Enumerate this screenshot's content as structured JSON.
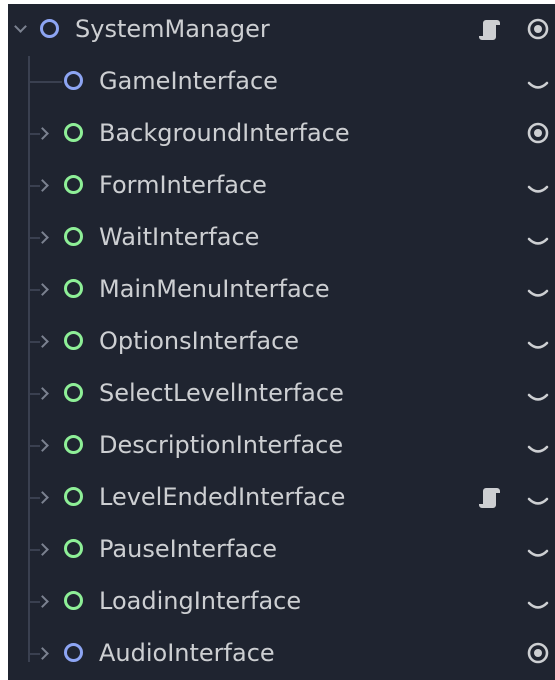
{
  "tree": {
    "root": {
      "label": "SystemManager",
      "icon": "node-icon-blue",
      "expanded": true,
      "has_script": true,
      "visible": true
    },
    "children": [
      {
        "label": "GameInterface",
        "icon": "node-icon-blue",
        "has_arrow": false,
        "has_script": false,
        "visible": false
      },
      {
        "label": "BackgroundInterface",
        "icon": "control-icon-green",
        "has_arrow": true,
        "has_script": false,
        "visible": true
      },
      {
        "label": "FormInterface",
        "icon": "control-icon-green",
        "has_arrow": true,
        "has_script": false,
        "visible": false
      },
      {
        "label": "WaitInterface",
        "icon": "control-icon-green",
        "has_arrow": true,
        "has_script": false,
        "visible": false
      },
      {
        "label": "MainMenuInterface",
        "icon": "control-icon-green",
        "has_arrow": true,
        "has_script": false,
        "visible": false
      },
      {
        "label": "OptionsInterface",
        "icon": "control-icon-green",
        "has_arrow": true,
        "has_script": false,
        "visible": false
      },
      {
        "label": "SelectLevelInterface",
        "icon": "control-icon-green",
        "has_arrow": true,
        "has_script": false,
        "visible": false
      },
      {
        "label": "DescriptionInterface",
        "icon": "control-icon-green",
        "has_arrow": true,
        "has_script": false,
        "visible": false
      },
      {
        "label": "LevelEndedInterface",
        "icon": "control-icon-green",
        "has_arrow": true,
        "has_script": true,
        "visible": false
      },
      {
        "label": "PauseInterface",
        "icon": "control-icon-green",
        "has_arrow": true,
        "has_script": false,
        "visible": false
      },
      {
        "label": "LoadingInterface",
        "icon": "control-icon-green",
        "has_arrow": true,
        "has_script": false,
        "visible": false
      },
      {
        "label": "AudioInterface",
        "icon": "node-icon-blue",
        "has_arrow": true,
        "has_script": false,
        "visible": true
      }
    ]
  },
  "colors": {
    "background": "#1f2430",
    "text": "#cdcfd2",
    "node_blue": "#8da5f3",
    "control_green": "#8eef97",
    "tree_line": "#3a4050",
    "icon_grey": "#cdcfd2"
  }
}
